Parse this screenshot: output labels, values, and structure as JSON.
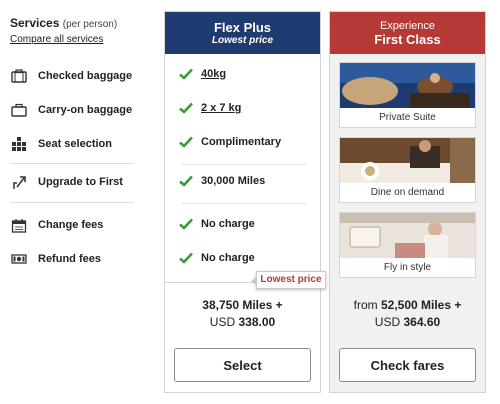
{
  "services": {
    "title": "Services",
    "title_suffix": "(per person)",
    "compare_link": "Compare all services",
    "rows": [
      {
        "label": "Checked baggage",
        "icon": "checked-baggage-icon"
      },
      {
        "label": "Carry-on baggage",
        "icon": "carry-on-baggage-icon"
      },
      {
        "label": "Seat selection",
        "icon": "seat-selection-icon"
      },
      {
        "label": "Upgrade to First",
        "icon": "upgrade-icon"
      },
      {
        "label": "Change fees",
        "icon": "calendar-icon"
      },
      {
        "label": "Refund fees",
        "icon": "cash-icon"
      }
    ]
  },
  "flex": {
    "title": "Flex Plus",
    "subtitle": "Lowest price",
    "features": [
      "40kg",
      "2 x 7 kg",
      "Complimentary",
      "30,000 Miles",
      "No charge",
      "No charge"
    ],
    "badge": "Lowest price",
    "price_line1": "38,750 Miles +",
    "price_line2_prefix": "USD",
    "price_line2_amount": "338.00",
    "button": "Select"
  },
  "first": {
    "title_top": "Experience",
    "title": "First Class",
    "images": [
      {
        "caption": "Private Suite"
      },
      {
        "caption": "Dine on demand"
      },
      {
        "caption": "Fly in style"
      }
    ],
    "price_prefix": "from",
    "price_miles": "52,500 Miles +",
    "price_line2_prefix": "USD",
    "price_line2_amount": "364.60",
    "button": "Check fares"
  },
  "colors": {
    "flex_header": "#1f3b70",
    "first_header": "#b53a36",
    "check": "#3a9a3a"
  }
}
